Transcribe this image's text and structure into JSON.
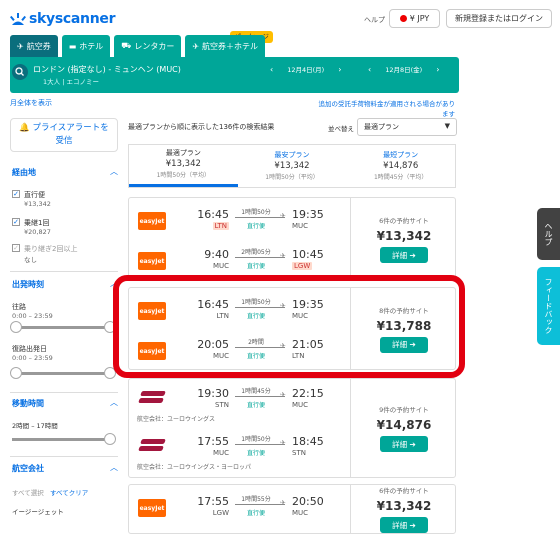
{
  "header": {
    "logo_text": "skyscanner",
    "help": "ヘルプ",
    "currency": "¥ JPY",
    "login": "新規登録またはログイン"
  },
  "tabs": [
    {
      "label": "航空券",
      "icon": "plane-icon"
    },
    {
      "label": "ホテル",
      "icon": "bed-icon"
    },
    {
      "label": "レンタカー",
      "icon": "car-icon"
    },
    {
      "label": "航空券＋ホテル",
      "icon": "plane-hotel-icon"
    }
  ],
  "package_badge": "パッケージ",
  "search": {
    "route": "ロンドン (指定なし) - ミュンヘン (MUC)",
    "pax": "1大人 | エコノミー",
    "depart_date": "12月4日(月)",
    "return_date": "12月8日(金)"
  },
  "month_link": "月全体を表示",
  "fee_note": "追加の受託手荷物料金が適用される場合があります",
  "sidebar": {
    "price_alert_line1": "🔔 プライスアラートを",
    "price_alert_line2": "受信",
    "stops_header": "経由地",
    "stops": [
      {
        "label": "直行便",
        "price": "¥13,342",
        "checked": true
      },
      {
        "label": "乗継1回",
        "price": "¥20,827",
        "checked": true
      },
      {
        "label": "乗り継ぎ2回以上",
        "price": "なし",
        "checked": true
      }
    ],
    "time_header": "出発時刻",
    "outbound_label": "往路",
    "outbound_range": "0:00 – 23:59",
    "return_label": "復路出発日",
    "return_range": "0:00 – 23:59",
    "duration_header": "移動時間",
    "duration_range": "2時間 – 17時間",
    "airline_header": "航空会社",
    "airline_all": "すべて選択",
    "airline_clear": "すべてクリア",
    "airline_first": "イージージェット"
  },
  "results": {
    "sort_info": "最適プランから順に表示した136件の検索結果",
    "sort_label": "並べ替え",
    "sort_value": "最適プラン",
    "summary": [
      {
        "title": "最適プラン",
        "price": "¥13,342",
        "duration": "1時間50分（平均）"
      },
      {
        "title": "最安プラン",
        "price": "¥13,342",
        "duration": "1時間50分（平均）"
      },
      {
        "title": "最短プラン",
        "price": "¥14,876",
        "duration": "1時間45分（平均）"
      }
    ],
    "cards": [
      {
        "sites": "6件の予約サイト",
        "price": "¥13,342",
        "select": "詳細 ➔",
        "legs": [
          {
            "airline": "easyJet",
            "dep": "16:45",
            "dep_ap": "LTN",
            "duration": "1時間50分",
            "stops": "直行便",
            "arr": "19:35",
            "arr_ap": "MUC",
            "operated": "",
            "dep_hl": true,
            "arr_hl": false
          },
          {
            "airline": "easyJet",
            "dep": "9:40",
            "dep_ap": "MUC",
            "duration": "2時間05分",
            "stops": "直行便",
            "arr": "10:45",
            "arr_ap": "LGW",
            "operated": "",
            "dep_hl": false,
            "arr_hl": true
          }
        ]
      },
      {
        "sites": "8件の予約サイト",
        "price": "¥13,788",
        "select": "詳細 ➔",
        "legs": [
          {
            "airline": "easyJet",
            "dep": "16:45",
            "dep_ap": "LTN",
            "duration": "1時間50分",
            "stops": "直行便",
            "arr": "19:35",
            "arr_ap": "MUC",
            "operated": "",
            "dep_hl": false,
            "arr_hl": false
          },
          {
            "airline": "easyJet",
            "dep": "20:05",
            "dep_ap": "MUC",
            "duration": "2時間",
            "stops": "直行便",
            "arr": "21:05",
            "arr_ap": "LTN",
            "operated": "",
            "dep_hl": false,
            "arr_hl": false
          }
        ]
      },
      {
        "sites": "9件の予約サイト",
        "price": "¥14,876",
        "select": "詳細 ➔",
        "legs": [
          {
            "airline": "Eurowings",
            "dep": "19:30",
            "dep_ap": "STN",
            "duration": "1時間45分",
            "stops": "直行便",
            "arr": "22:15",
            "arr_ap": "MUC",
            "operated": "航空会社：ユーロウイングス",
            "dep_hl": false,
            "arr_hl": false
          },
          {
            "airline": "Eurowings",
            "dep": "17:55",
            "dep_ap": "MUC",
            "duration": "1時間50分",
            "stops": "直行便",
            "arr": "18:45",
            "arr_ap": "STN",
            "operated": "航空会社：ユーロウイングス・ヨーロッパ",
            "dep_hl": false,
            "arr_hl": false
          }
        ]
      },
      {
        "sites": "6件の予約サイト",
        "price": "¥13,342",
        "select": "詳細 ➔",
        "legs": [
          {
            "airline": "easyJet",
            "dep": "17:55",
            "dep_ap": "LGW",
            "duration": "1時間55分",
            "stops": "直行便",
            "arr": "20:50",
            "arr_ap": "MUC",
            "operated": "",
            "dep_hl": false,
            "arr_hl": false
          }
        ]
      }
    ]
  },
  "side_tabs": {
    "help": "ヘルプ",
    "feedback": "フィードバック"
  },
  "colors": {
    "brand": "#0770e3",
    "teal": "#00a698",
    "highlight": "#e20010",
    "easyjet": "#ff6600"
  }
}
